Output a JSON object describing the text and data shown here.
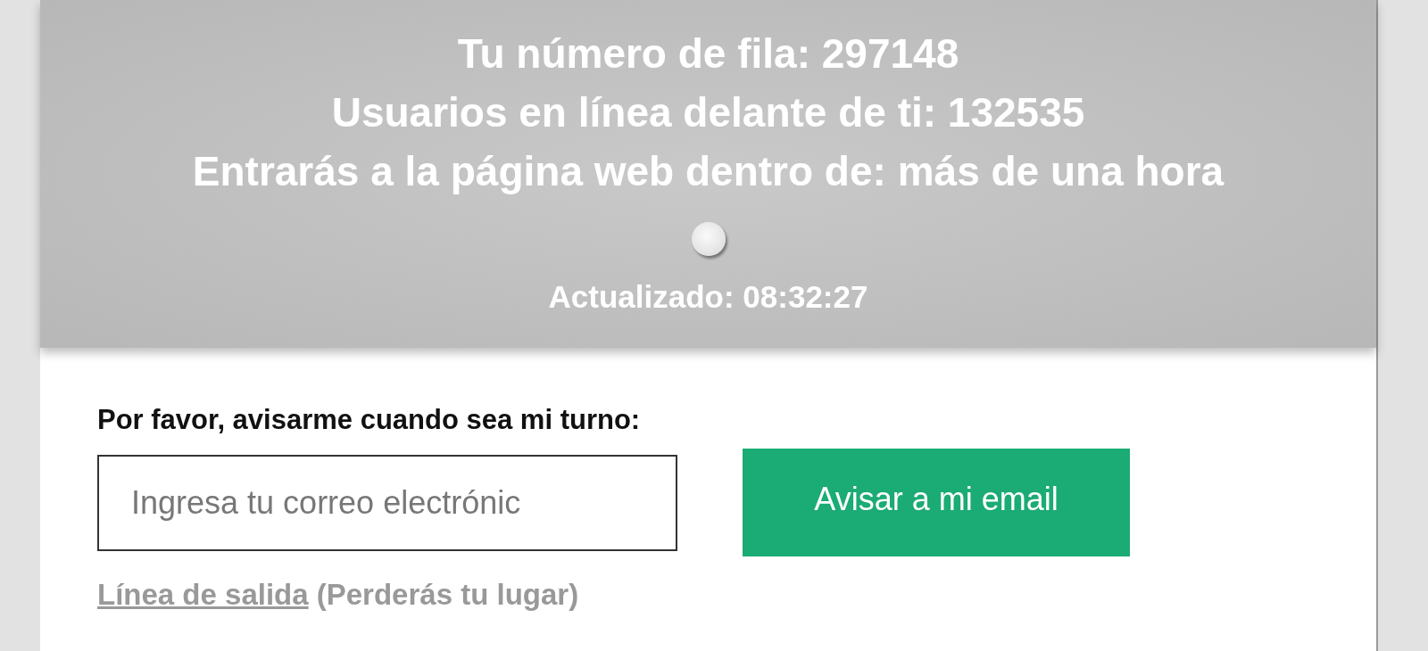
{
  "queue": {
    "lines": [
      "Tu número de fila: 297148",
      "Usuarios en línea delante de ti: 132535",
      "Entrarás a la página web dentro de: más de una hora"
    ],
    "updated": "Actualizado: 08:32:27"
  },
  "notify": {
    "label": "Por favor, avisarme cuando sea mi turno:",
    "email": {
      "placeholder": "Ingresa tu correo electrónic"
    },
    "button": "Avisar a mi email"
  },
  "exit": {
    "link": "Línea de salida",
    "note": "(Perderás tu lugar)"
  }
}
